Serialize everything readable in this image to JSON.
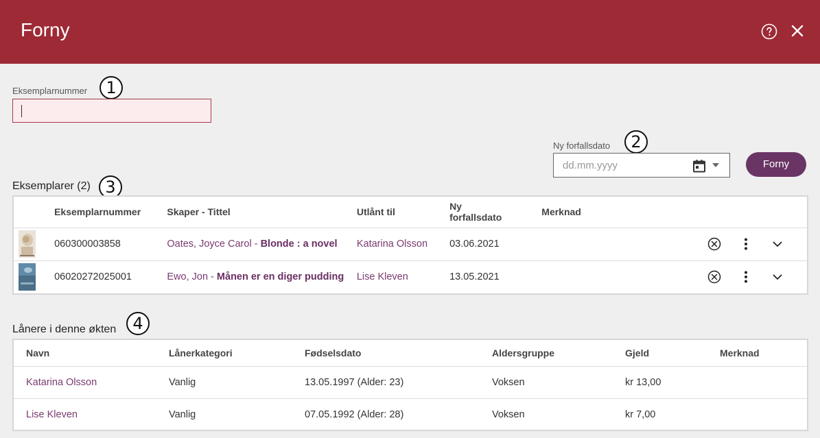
{
  "dialog": {
    "title": "Forny",
    "help_icon": "help-circle-icon",
    "close_icon": "close-icon"
  },
  "callouts": [
    "1",
    "2",
    "3",
    "4"
  ],
  "copy_number": {
    "label": "Eksemplarnummer",
    "value": ""
  },
  "due_date": {
    "label": "Ny forfallsdato",
    "placeholder": "dd.mm.yyyy",
    "calendar_icon": "calendar-icon",
    "dropdown_icon": "caret-down-icon"
  },
  "renew_button": {
    "label": "Forny"
  },
  "copies": {
    "title": "Eksemplarer (2)",
    "columns": {
      "number": "Eksemplarnummer",
      "creator_title": "Skaper - Tittel",
      "loaned_to": "Utlånt til",
      "due_line1": "Ny",
      "due_line2": "forfallsdato",
      "note": "Merknad"
    },
    "rows": [
      {
        "number": "060300003858",
        "creator": "Oates, Joyce Carol",
        "separator": " - ",
        "title": "Blonde : a novel",
        "loaned_to": "Katarina Olsson",
        "due": "03.06.2021",
        "note": ""
      },
      {
        "number": "06020272025001",
        "creator": "Ewo, Jon",
        "separator": " - ",
        "title": "Månen er en diger pudding",
        "loaned_to": "Lise Kleven",
        "due": "13.05.2021",
        "note": ""
      }
    ]
  },
  "borrowers": {
    "title": "Lånere i denne økten",
    "columns": {
      "name": "Navn",
      "category": "Lånerkategori",
      "birth": "Fødselsdato",
      "age_group": "Aldersgruppe",
      "debt": "Gjeld",
      "note": "Merknad"
    },
    "rows": [
      {
        "name": "Katarina Olsson",
        "category": "Vanlig",
        "birth": "13.05.1997 (Alder: 23)",
        "age_group": "Voksen",
        "debt": "kr 13,00",
        "note": ""
      },
      {
        "name": "Lise Kleven",
        "category": "Vanlig",
        "birth": "07.05.1992 (Alder: 28)",
        "age_group": "Voksen",
        "debt": "kr 7,00",
        "note": ""
      }
    ]
  },
  "colors": {
    "header": "#9e2a36",
    "button": "#6a3565",
    "link": "#7a3a70",
    "input_error_bg": "#fdecee"
  }
}
